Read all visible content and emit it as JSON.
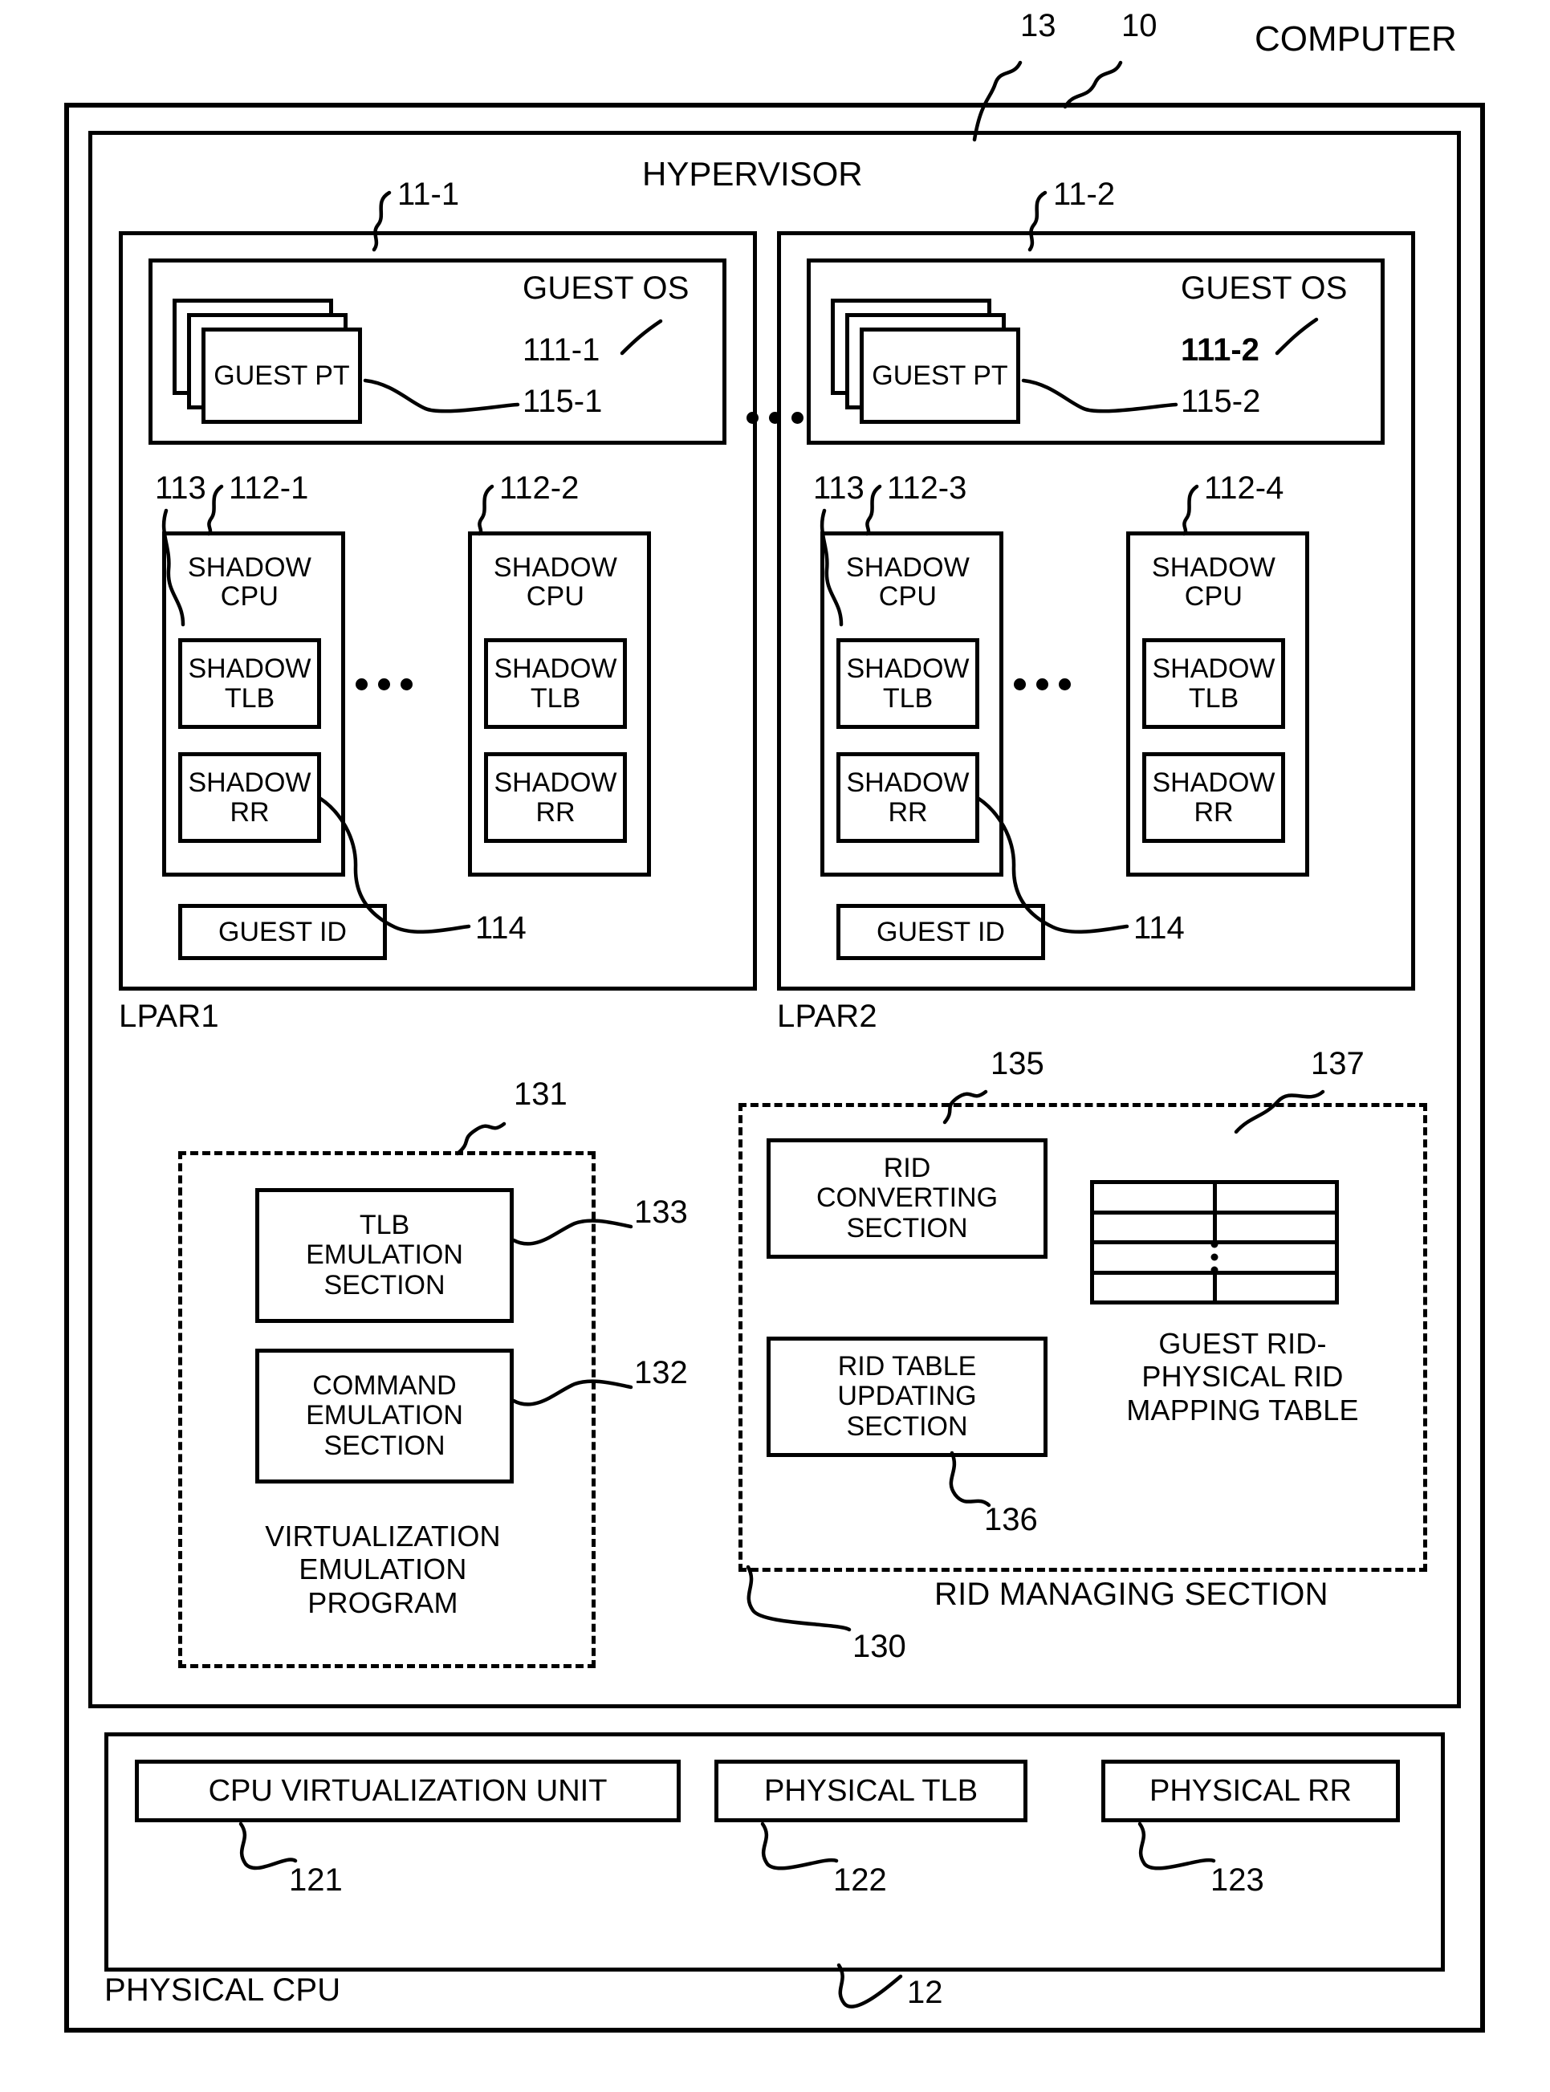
{
  "figure": {
    "title": "COMPUTER",
    "outer_ref": "10",
    "hypervisor": {
      "label": "HYPERVISOR",
      "ref": "13"
    },
    "lpars": [
      {
        "name": "LPAR1",
        "ref": "11-1",
        "guest_os": {
          "label": "GUEST OS",
          "ref": "111-1",
          "guest_pt": {
            "label": "GUEST PT",
            "ref": "115-1"
          }
        },
        "shadow_cpus": [
          {
            "label": "SHADOW CPU",
            "ref": "112-1",
            "shadow_tlb": {
              "label": "SHADOW TLB",
              "ref": "113"
            },
            "shadow_rr": {
              "label": "SHADOW RR",
              "ref": "114"
            }
          },
          {
            "label": "SHADOW CPU",
            "ref": "112-2",
            "shadow_tlb": {
              "label": "SHADOW TLB"
            },
            "shadow_rr": {
              "label": "SHADOW RR"
            }
          }
        ],
        "guest_id": {
          "label": "GUEST ID"
        }
      },
      {
        "name": "LPAR2",
        "ref": "11-2",
        "guest_os": {
          "label": "GUEST OS",
          "ref": "111-2",
          "guest_pt": {
            "label": "GUEST PT",
            "ref": "115-2"
          }
        },
        "shadow_cpus": [
          {
            "label": "SHADOW CPU",
            "ref": "112-3",
            "shadow_tlb": {
              "label": "SHADOW TLB",
              "ref": "113"
            },
            "shadow_rr": {
              "label": "SHADOW RR",
              "ref": "114"
            }
          },
          {
            "label": "SHADOW CPU",
            "ref": "112-4",
            "shadow_tlb": {
              "label": "SHADOW TLB"
            },
            "shadow_rr": {
              "label": "SHADOW RR"
            }
          }
        ],
        "guest_id": {
          "label": "GUEST ID"
        }
      }
    ],
    "virtualization_emulation_program": {
      "label": "VIRTUALIZATION EMULATION PROGRAM",
      "line1": "VIRTUALIZATION",
      "line2": "EMULATION",
      "line3": "PROGRAM",
      "ref": "131",
      "sections": [
        {
          "label": "TLB EMULATION SECTION",
          "line1": "TLB",
          "line2": "EMULATION",
          "line3": "SECTION",
          "ref": "133"
        },
        {
          "label": "COMMAND EMULATION SECTION",
          "line1": "COMMAND",
          "line2": "EMULATION",
          "line3": "SECTION",
          "ref": "132"
        }
      ]
    },
    "rid_managing_section": {
      "label": "RID MANAGING SECTION",
      "ref": "130",
      "sections": [
        {
          "label": "RID CONVERTING SECTION",
          "line1": "RID",
          "line2": "CONVERTING",
          "line3": "SECTION",
          "ref": "135"
        },
        {
          "label": "RID TABLE UPDATING SECTION",
          "line1": "RID TABLE",
          "line2": "UPDATING",
          "line3": "SECTION",
          "ref": "136"
        }
      ],
      "mapping_table": {
        "label": "GUEST RID-PHYSICAL RID MAPPING TABLE",
        "line1": "GUEST RID-",
        "line2": "PHYSICAL RID",
        "line3": "MAPPING TABLE",
        "ref": "137",
        "rows": 4,
        "columns": 2
      }
    },
    "physical_cpu": {
      "label": "PHYSICAL CPU",
      "ref": "12",
      "units": [
        {
          "label": "CPU VIRTUALIZATION UNIT",
          "ref": "121"
        },
        {
          "label": "PHYSICAL TLB",
          "ref": "122"
        },
        {
          "label": "PHYSICAL RR",
          "ref": "123"
        }
      ]
    },
    "ellipsis_label": "..."
  }
}
